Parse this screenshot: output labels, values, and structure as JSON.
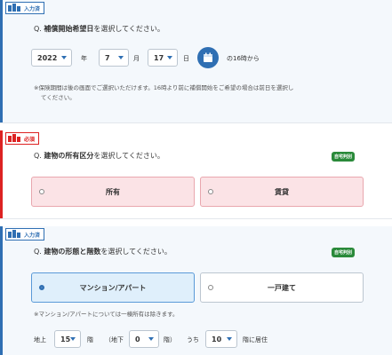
{
  "section1": {
    "badge": "入力済",
    "question_prefix": "Q.",
    "question_bold": "補償開始希望日",
    "question_rest": "を選択してください。",
    "year": "2022",
    "year_unit": "年",
    "month": "7",
    "month_unit": "月",
    "day": "17",
    "day_unit": "日",
    "time_suffix": "の16時から",
    "note_line1": "※保険期間は後の画面でご選択いただけます。16時より前に補償開始をご希望の場合は前日を選択し",
    "note_line2": "てください。"
  },
  "section2": {
    "badge": "必須",
    "question_prefix": "Q.",
    "question_bold": "建物の所有区分",
    "question_rest": "を選択してください。",
    "tag": "自宅判別",
    "options": [
      "所有",
      "賃貸"
    ]
  },
  "section3": {
    "badge": "入力済",
    "question_prefix": "Q.",
    "question_bold": "建物の形態と階数",
    "question_rest": "を選択してください。",
    "tag": "自宅判別",
    "options": [
      "マンション/アパート",
      "一戸建て"
    ],
    "note": "※マンション/アパートについては一棟所有は除きます。",
    "floors": {
      "above_label": "地上",
      "above_value": "15",
      "above_unit": "階",
      "below_label": "（地下",
      "below_value": "0",
      "below_unit": "階）",
      "living_label": "うち",
      "living_value": "10",
      "living_unit": "階に居住"
    }
  },
  "colors": {
    "primary": "#2f6fb3",
    "required": "#dd2222",
    "tag": "#2a8a3a",
    "pink": "#fbe3e6"
  },
  "icons": [
    "building-icon",
    "calendar-icon",
    "radio-icon",
    "chevron-down-icon"
  ]
}
